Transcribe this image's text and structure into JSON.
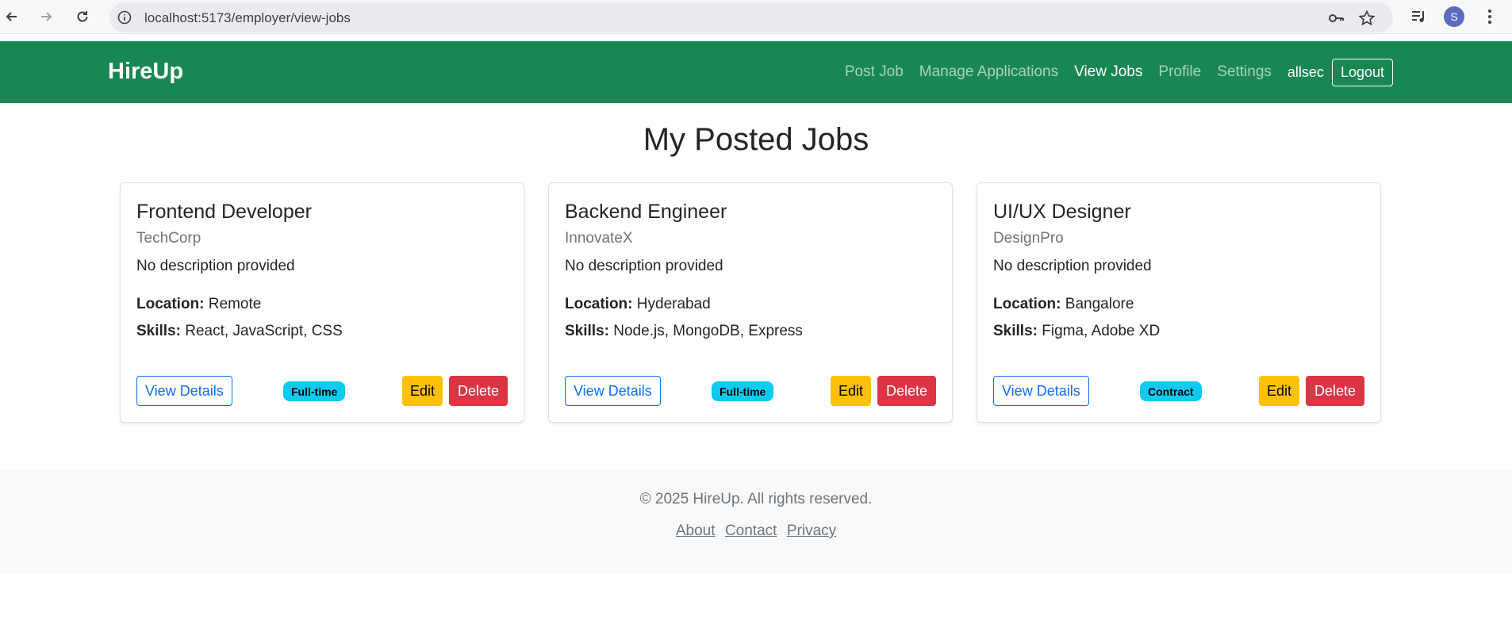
{
  "browser": {
    "url": "localhost:5173/employer/view-jobs",
    "profile_initial": "S"
  },
  "navbar": {
    "brand": "HireUp",
    "links": [
      {
        "label": "Post Job",
        "active": false
      },
      {
        "label": "Manage Applications",
        "active": false
      },
      {
        "label": "View Jobs",
        "active": true
      },
      {
        "label": "Profile",
        "active": false
      },
      {
        "label": "Settings",
        "active": false
      }
    ],
    "username": "allsec",
    "logout_label": "Logout",
    "color": "#198754"
  },
  "main": {
    "title": "My Posted Jobs",
    "jobs": [
      {
        "title": "Frontend Developer",
        "company": "TechCorp",
        "description": "No description provided",
        "location_label": "Location:",
        "location": "Remote",
        "skills_label": "Skills:",
        "skills": "React, JavaScript, CSS",
        "view_label": "View Details",
        "type": "Full-time",
        "edit_label": "Edit",
        "delete_label": "Delete"
      },
      {
        "title": "Backend Engineer",
        "company": "InnovateX",
        "description": "No description provided",
        "location_label": "Location:",
        "location": "Hyderabad",
        "skills_label": "Skills:",
        "skills": "Node.js, MongoDB, Express",
        "view_label": "View Details",
        "type": "Full-time",
        "edit_label": "Edit",
        "delete_label": "Delete"
      },
      {
        "title": "UI/UX Designer",
        "company": "DesignPro",
        "description": "No description provided",
        "location_label": "Location:",
        "location": "Bangalore",
        "skills_label": "Skills:",
        "skills": "Figma, Adobe XD",
        "view_label": "View Details",
        "type": "Contract",
        "edit_label": "Edit",
        "delete_label": "Delete"
      }
    ]
  },
  "footer": {
    "copyright": "© 2025 HireUp. All rights reserved.",
    "links": [
      "About",
      "Contact",
      "Privacy"
    ]
  }
}
